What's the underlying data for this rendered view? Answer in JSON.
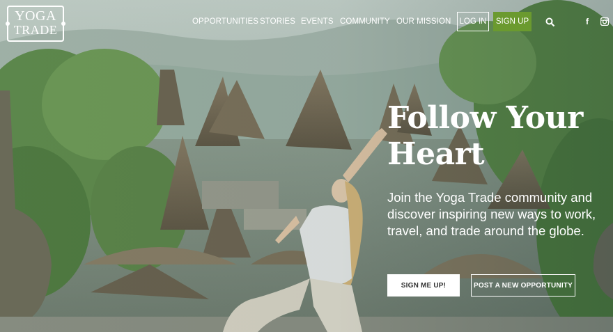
{
  "brand": {
    "logo_line1": "YOGA",
    "logo_line2": "TRADE"
  },
  "nav": {
    "items": [
      {
        "label": "OPPORTUNITIES"
      },
      {
        "label": "STORIES"
      },
      {
        "label": "EVENTS"
      },
      {
        "label": "COMMUNITY"
      },
      {
        "label": "OUR MISSION"
      }
    ],
    "login_label": "LOG IN",
    "signup_label": "SIGN UP",
    "icons": [
      "search-icon",
      "facebook-icon",
      "instagram-icon"
    ]
  },
  "hero": {
    "title_line1": "Follow Your",
    "title_line2": "Heart",
    "subtitle": "Join the Yoga Trade community and discover inspiring new ways to work, travel, and trade around the globe.",
    "cta_primary": "SIGN ME UP!",
    "cta_secondary": "POST A NEW OPPORTUNITY"
  },
  "colors": {
    "signup_green": "#6b9a2f",
    "text": "#ffffff",
    "cta_text": "#333333"
  }
}
